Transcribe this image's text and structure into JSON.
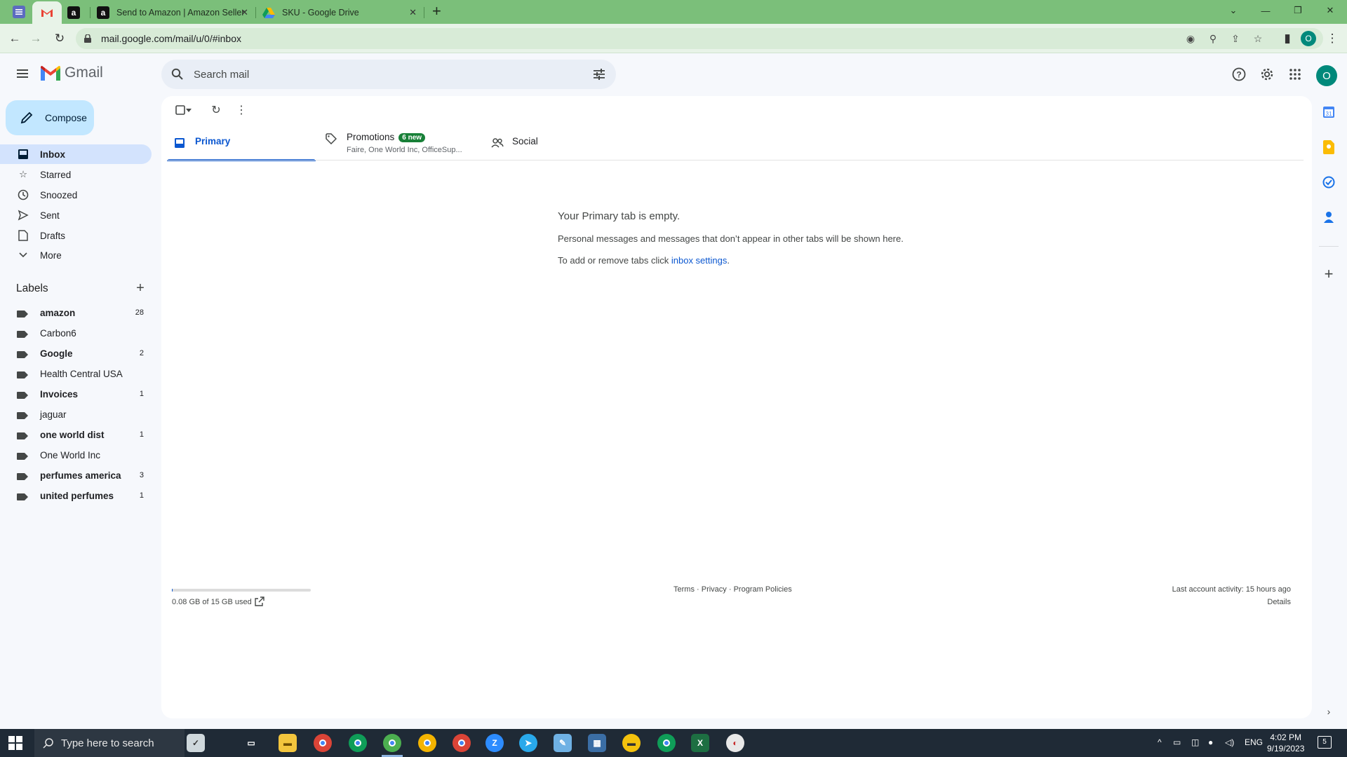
{
  "browser": {
    "tabs": [
      {
        "title": "",
        "favicon": "gmail-m"
      },
      {
        "title": "",
        "favicon": "amazon-a"
      },
      {
        "title": "Send to Amazon | Amazon Seller",
        "favicon": "amazon-a"
      },
      {
        "title": "SKU - Google Drive",
        "favicon": "drive-triangle"
      }
    ],
    "url": "mail.google.com/mail/u/0/#inbox",
    "profile_initial": "O"
  },
  "gmail": {
    "logo_text": "Gmail",
    "search_placeholder": "Search mail",
    "avatar_initial": "O",
    "compose_label": "Compose",
    "nav": [
      {
        "label": "Inbox",
        "icon": "inbox-icon"
      },
      {
        "label": "Starred",
        "icon": "star-icon"
      },
      {
        "label": "Snoozed",
        "icon": "clock-icon"
      },
      {
        "label": "Sent",
        "icon": "send-icon"
      },
      {
        "label": "Drafts",
        "icon": "draft-icon"
      },
      {
        "label": "More",
        "icon": "chevron-down-icon"
      }
    ],
    "labels_title": "Labels",
    "labels": [
      {
        "name": "amazon",
        "count": "28",
        "bold": true
      },
      {
        "name": "Carbon6",
        "count": "",
        "bold": false
      },
      {
        "name": "Google",
        "count": "2",
        "bold": true
      },
      {
        "name": "Health Central USA",
        "count": "",
        "bold": false
      },
      {
        "name": "Invoices",
        "count": "1",
        "bold": true
      },
      {
        "name": "jaguar",
        "count": "",
        "bold": false
      },
      {
        "name": "one world dist",
        "count": "1",
        "bold": true
      },
      {
        "name": "One World Inc",
        "count": "",
        "bold": false
      },
      {
        "name": "perfumes america",
        "count": "3",
        "bold": true
      },
      {
        "name": "united perfumes",
        "count": "1",
        "bold": true
      }
    ],
    "category_tabs": {
      "primary": {
        "label": "Primary"
      },
      "promotions": {
        "label": "Promotions",
        "badge": "6 new",
        "subtitle": "Faire, One World Inc, OfficeSup..."
      },
      "social": {
        "label": "Social"
      }
    },
    "empty": {
      "title": "Your Primary tab is empty.",
      "description": "Personal messages and messages that don’t appear in other tabs will be shown here.",
      "hint_prefix": "To add or remove tabs click ",
      "hint_link": "inbox settings",
      "hint_suffix": "."
    },
    "footer": {
      "storage": "0.08 GB of 15 GB used",
      "storage_fraction": 0.005,
      "terms": "Terms",
      "privacy": "Privacy",
      "policies": "Program Policies",
      "activity": "Last account activity: 15 hours ago",
      "details": "Details"
    }
  },
  "taskbar": {
    "search_placeholder": "Type here to search",
    "language": "ENG",
    "time": "4:02 PM",
    "date": "9/19/2023",
    "notifications": "5"
  },
  "colors": {
    "browser_frame": "#7bbf7a",
    "accent": "#0b57d0",
    "compose": "#c2e7ff",
    "active_nav": "#d3e3fd"
  }
}
